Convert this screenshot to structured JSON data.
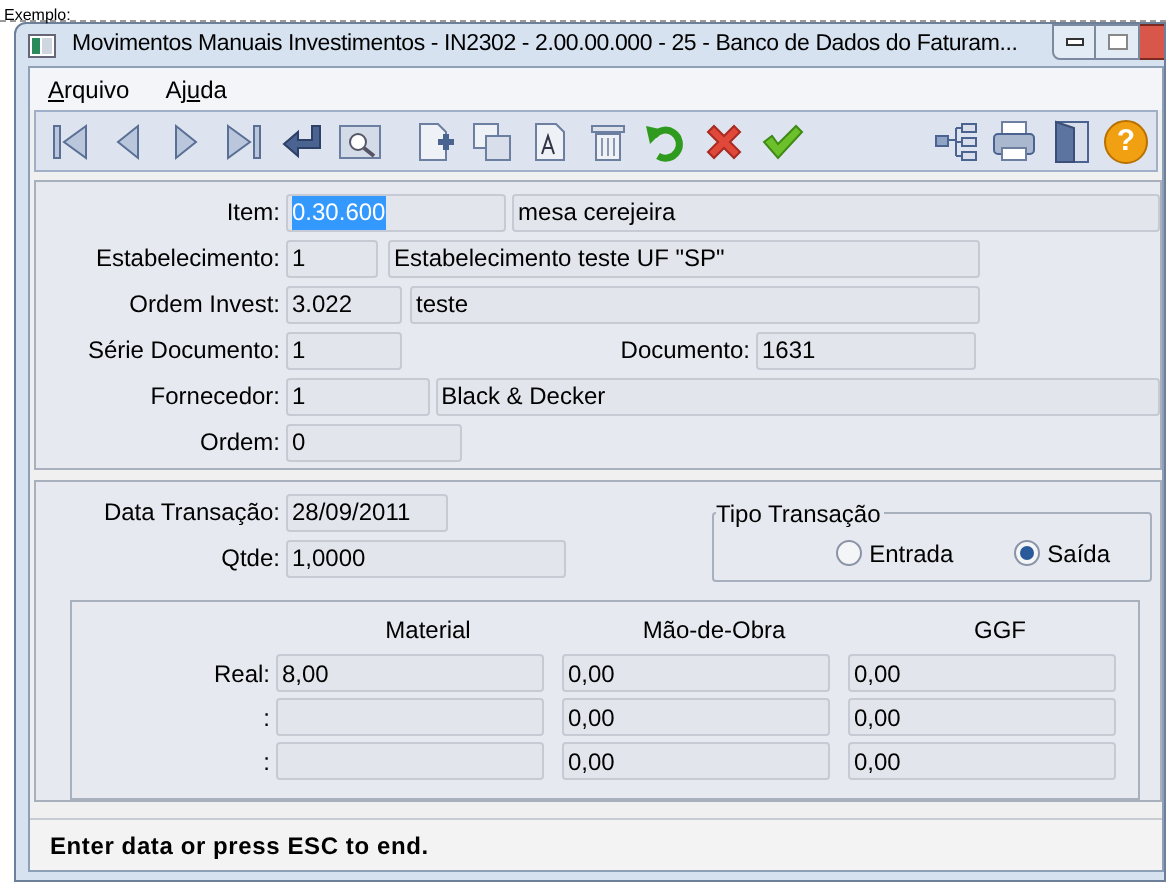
{
  "page_caption": "Exemplo:",
  "window": {
    "title": "Movimentos Manuais Investimentos - IN2302 - 2.00.00.000 - 25 - Banco de Dados do Faturam..."
  },
  "menu": [
    {
      "key": "A",
      "after": "rquivo"
    },
    {
      "before": "Aj",
      "key": "u",
      "after": "da"
    }
  ],
  "toolbar": {
    "help_glyph": "?"
  },
  "header_fields": [
    {
      "kind": "code_desc",
      "label": "Item:",
      "value": "0.30.600",
      "text_selected": true,
      "description": "mesa cerejeira"
    },
    {
      "kind": "code_desc",
      "label": "Estabelecimento:",
      "value": "1",
      "text_selected": false,
      "description": "Estabelecimento teste UF \"SP\""
    },
    {
      "kind": "code_desc",
      "label": "Ordem Invest:",
      "value": "3.022",
      "text_selected": false,
      "description": "teste"
    },
    {
      "kind": "pair",
      "label": "Série Documento:",
      "value": "1",
      "text_selected": false,
      "label2": "Documento:",
      "value2": "1631"
    },
    {
      "kind": "code_desc",
      "label": "Fornecedor:",
      "value": "1",
      "text_selected": false,
      "description": "Black & Decker"
    },
    {
      "kind": "single",
      "label": "Ordem:",
      "value": "0",
      "text_selected": false
    }
  ],
  "transaction": {
    "date_label": "Data Transação:",
    "date": "28/09/2011",
    "qty_label": "Qtde:",
    "qty": "1,0000",
    "type_group": {
      "title": "Tipo Transação",
      "options": [
        {
          "label": "Entrada",
          "selected": false
        },
        {
          "label": "Saída",
          "selected": true
        }
      ]
    }
  },
  "costs": {
    "columns": [
      "Material",
      "Mão-de-Obra",
      "GGF"
    ],
    "rows": [
      {
        "label": "Real:",
        "cells": [
          {
            "value": "8,00"
          },
          {
            "value": "0,00"
          },
          {
            "value": "0,00"
          }
        ]
      },
      {
        "label": ":",
        "cells": [
          {},
          {
            "value": "0,00"
          },
          {
            "value": "0,00"
          }
        ]
      },
      {
        "label": ":",
        "cells": [
          {},
          {
            "value": "0,00"
          },
          {
            "value": "0,00"
          }
        ]
      }
    ]
  },
  "status_bar": "Enter data or press ESC to end."
}
